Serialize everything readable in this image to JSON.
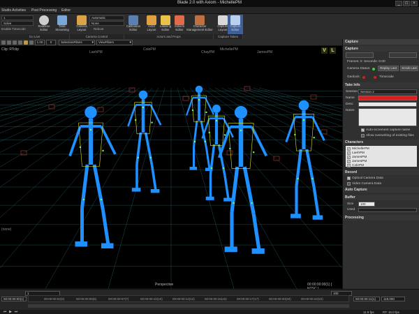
{
  "window": {
    "title": "Blade 2.0 with Axiom - MichellePM",
    "min": "_",
    "max": "□",
    "close": "×"
  },
  "menu": {
    "tabs": [
      "Studio Activities",
      "Post Processing",
      "Editor"
    ]
  },
  "ribbon": {
    "fields": {
      "field1": "1",
      "solve": "Solve",
      "timecode": "Enable Timecode",
      "automatic": "Automatic",
      "none": "None",
      "reboot": "Reboot"
    },
    "buttons": {
      "realtime": "Realtime\nEditor",
      "data_streaming": "Data\nStreaming",
      "camera_layout": "Camera\nLayout",
      "calibration": "Calibration\nEditor",
      "actor_layout": "Actor\nLayout",
      "labeling": "Labeling\nEditor",
      "solvers": "Solvers\nEditor",
      "character_mgmt": "Character\nManagement Editor",
      "capture_layout": "Capture\nLayout",
      "capture_editor": "Capture\nEditor"
    },
    "groups": {
      "golive": "Go Live",
      "camera_control": "Camera Control",
      "actors_props": "Actors and Props",
      "capture_takes": "Capture Takes"
    }
  },
  "toolbar": {
    "num1": "1.00",
    "num2": "0",
    "selection_filters": "SelectionFilters",
    "view_filters": "ViewFilters",
    "v": "V",
    "l": "L"
  },
  "viewport": {
    "clip_label": "Clip: RTclip",
    "camera_label": "(none)",
    "perspective": "Perspective",
    "timecode": "00:00:00:00(1) [ NTSC ]",
    "actor_labels": [
      "LaehPM",
      "ColePM",
      "ChayPM",
      "MichellePM",
      "JamesPM"
    ]
  },
  "panel": {
    "header": "Capture",
    "capture_section": "Capture",
    "frames": "Frames: 0",
    "seconds": "Seconds: 0.00",
    "camera_status": "Camera Status:",
    "replay_last": "Replay Last",
    "scrub_last": "Scrub Last",
    "genlock": "Genlock:",
    "timecode": "Timecode",
    "take_info": "Take Info",
    "session_label": "Session",
    "session_value": "Session 2",
    "name_label": "Name",
    "desc_label": "Desc",
    "notes_label": "Notes",
    "auto_increment": "Auto-increment capture name",
    "allow_overwrite": "Allow overwriting of existing files",
    "characters_header": "Characters",
    "characters": [
      "MichellePM",
      "LaehPM",
      "JamesPM",
      "JamesPM",
      "ColePM"
    ],
    "record_header": "Record",
    "optical": "Optical Camera Data",
    "video": "Video Camera Data",
    "auto_capture": "Auto Capture",
    "buffer_header": "Buffer",
    "size_label": "Size",
    "size_value": "100",
    "used_label": "Used",
    "processing_header": "Processing"
  },
  "timeline": {
    "start": "1",
    "range_start": "00:00:00:00(1)",
    "end": "119.000",
    "end_field": "100",
    "current": "0",
    "ticks": [
      "00:00:00:02(2)",
      "00:00:00:05(5)",
      "00:00:00:07(7)",
      "00:00:00:10(10)",
      "00:00:00:12(12)",
      "00:00:00:15(15)",
      "00:00:00:17(17)",
      "00:00:00:20(20)",
      "00:00:00:22(22)",
      "00:00:00:25(25)"
    ],
    "right_field": "00:00:00:11(1)",
    "status_fps": "11.9 fps",
    "status_rt": "RT: 16.0 fps",
    "status_mode": "P: 1/16.0 fps"
  },
  "colors": {
    "accent_red": "#d32020",
    "status_green": "#3cd23c",
    "figure_blue": "#1e90ff",
    "marker_yellow": "#e6e619",
    "grid": "#2d6e73"
  },
  "icons": [
    "realtime-icon",
    "streaming-icon",
    "camera-layout-icon",
    "calibration-icon",
    "actor-icon",
    "labeling-icon",
    "solvers-icon",
    "character-icon",
    "capture-layout-icon",
    "capture-editor-icon"
  ]
}
